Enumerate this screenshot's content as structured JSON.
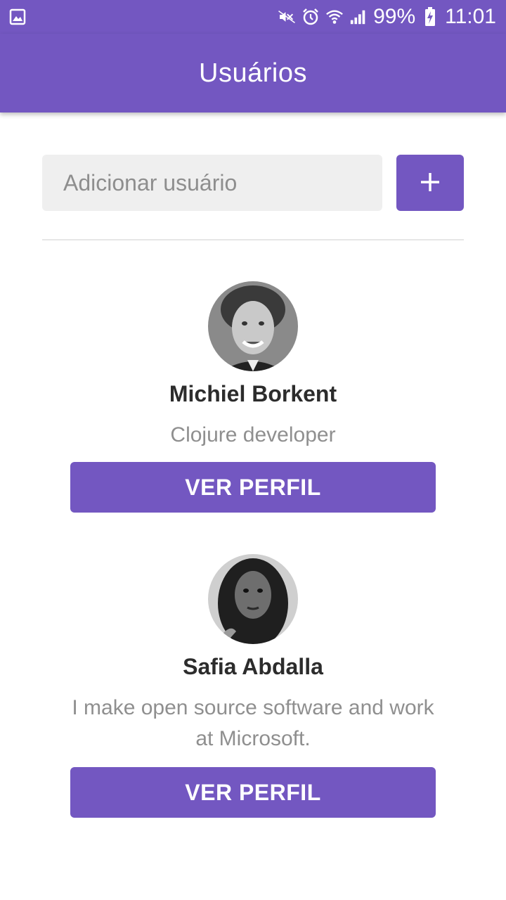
{
  "status_bar": {
    "battery": "99%",
    "time": "11:01",
    "icons": [
      "gallery-icon",
      "mute-icon",
      "alarm-icon",
      "wifi-icon",
      "signal-icon",
      "battery-charging-icon"
    ]
  },
  "app_bar": {
    "title": "Usuários"
  },
  "add_user": {
    "placeholder": "Adicionar usuário",
    "button_icon": "plus-icon"
  },
  "users": [
    {
      "name": "Michiel Borkent",
      "bio": "Clojure developer",
      "button_label": "VER PERFIL"
    },
    {
      "name": "Safia Abdalla",
      "bio": "I make open source software and work at Microsoft.",
      "button_label": "VER PERFIL"
    }
  ],
  "colors": {
    "primary": "#7357c1",
    "input_bg": "#efefef",
    "name_text": "#2c2c2c",
    "bio_text": "#8f8f8f"
  }
}
